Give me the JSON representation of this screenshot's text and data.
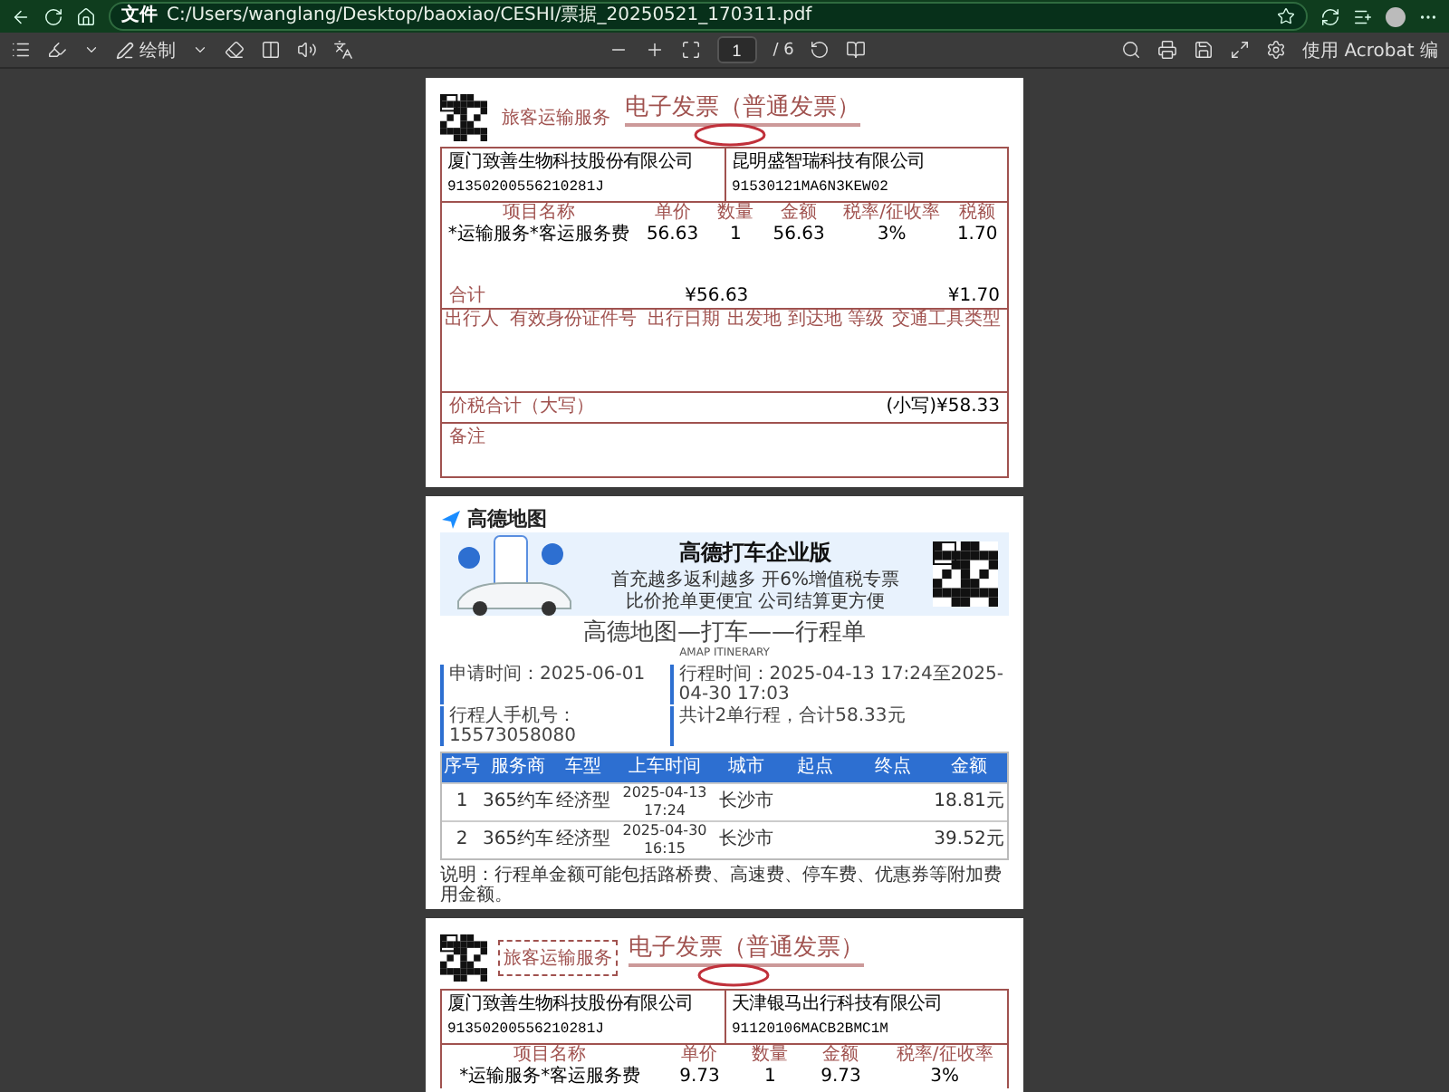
{
  "browser": {
    "file_badge": "文件",
    "address": "C:/Users/wanglang/Desktop/baoxiao/CESHI/票据_20250521_170311.pdf"
  },
  "pdf_toolbar": {
    "draw_label": "绘制",
    "page_input": "1",
    "page_total": "/ 6",
    "acrobat_button": "使用 Acrobat 编"
  },
  "pages": [
    {
      "kind": "invoice",
      "service_label": "旅客运输服务",
      "service_boxed": false,
      "title": "电子发票（普通发票）",
      "buyer_name": "厦门致善生物科技股份有限公司",
      "buyer_tax_id": "91350200556210281J",
      "seller_name": "昆明盛智瑞科技有限公司",
      "seller_tax_id": "91530121MA6N3KEW02",
      "columns": [
        "项目名称",
        "单价",
        "数量",
        "金额",
        "税率/征收率",
        "税额"
      ],
      "items": [
        {
          "name": "*运输服务*客运服务费",
          "price": "56.63",
          "quantity": "1",
          "amount": "56.63",
          "tax_rate": "3%",
          "tax": "1.70"
        }
      ],
      "total_label": "合计",
      "total_amount": "¥56.63",
      "total_tax": "¥1.70",
      "travel_columns": [
        "出行人",
        "有效身份证件号",
        "出行日期",
        "出发地",
        "到达地",
        "等级",
        "交通工具类型"
      ],
      "grand_total_label": "价税合计（大写）",
      "grand_total": "(小写)¥58.33",
      "remarks_label": "备注"
    },
    {
      "kind": "itinerary",
      "logo": "高德地图",
      "banner_title": "高德打车企业版",
      "banner_lines": [
        "首充越多返利越多 开6%增值税专票",
        "比价抢单更便宜 公司结算更方便"
      ],
      "title": "高德地图—打车——行程单",
      "subtitle": "AMAP ITINERARY",
      "info": [
        "申请时间：2025-06-01",
        "行程时间：2025-04-13 17:24至2025-04-30 17:03",
        "行程人手机号：15573058080",
        "共计2单行程，合计58.33元"
      ],
      "columns": [
        "序号",
        "服务商",
        "车型",
        "上车时间",
        "城市",
        "起点",
        "终点",
        "金额"
      ],
      "rows": [
        [
          "1",
          "365约车",
          "经济型",
          "2025-04-13 17:24",
          "长沙市",
          "",
          "",
          "18.81元"
        ],
        [
          "2",
          "365约车",
          "经济型",
          "2025-04-30 16:15",
          "长沙市",
          "",
          "",
          "39.52元"
        ]
      ],
      "note": "说明：行程单金额可能包括路桥费、高速费、停车费、优惠券等附加费用金额。"
    },
    {
      "kind": "invoice",
      "service_label": "旅客运输服务",
      "service_boxed": true,
      "title": "电子发票（普通发票）",
      "buyer_name": "厦门致善生物科技股份有限公司",
      "buyer_tax_id": "91350200556210281J",
      "seller_name": "天津银马出行科技有限公司",
      "seller_tax_id": "91120106MACB2BMC1M",
      "columns": [
        "项目名称",
        "单价",
        "数量",
        "金额",
        "税率/征收率"
      ],
      "items": [
        {
          "name": "*运输服务*客运服务费",
          "price": "9.73",
          "quantity": "1",
          "amount": "9.73",
          "tax_rate": "3%"
        }
      ]
    }
  ]
}
